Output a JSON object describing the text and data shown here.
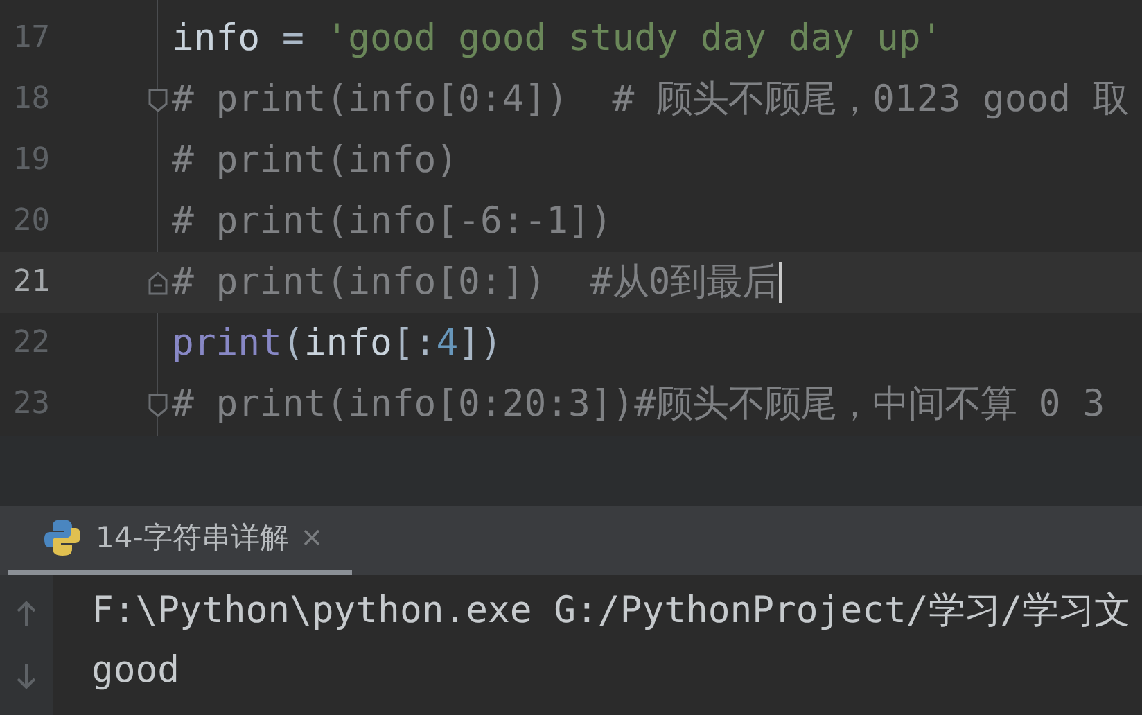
{
  "editor": {
    "lines": [
      {
        "number": "17",
        "current": false,
        "fold_start": false,
        "fold_end": false,
        "tokens": [
          {
            "kind": "ident",
            "text": "info "
          },
          {
            "kind": "op",
            "text": "= "
          },
          {
            "kind": "string",
            "text": "'good good study day day up'"
          }
        ]
      },
      {
        "number": "18",
        "current": false,
        "fold_start": true,
        "fold_end": false,
        "tokens": [
          {
            "kind": "comment",
            "text": "# print(info[0:4])  # 顾头不顾尾，0123 good 取"
          }
        ]
      },
      {
        "number": "19",
        "current": false,
        "fold_start": false,
        "fold_end": false,
        "tokens": [
          {
            "kind": "comment",
            "text": "# print(info)"
          }
        ]
      },
      {
        "number": "20",
        "current": false,
        "fold_start": false,
        "fold_end": false,
        "tokens": [
          {
            "kind": "comment",
            "text": "# print(info[-6:-1])"
          }
        ]
      },
      {
        "number": "21",
        "current": true,
        "fold_start": false,
        "fold_end": true,
        "tokens": [
          {
            "kind": "comment",
            "text": "# print(info[0:])  #从0到最后"
          }
        ]
      },
      {
        "number": "22",
        "current": false,
        "fold_start": false,
        "fold_end": false,
        "tokens": [
          {
            "kind": "builtin",
            "text": "print"
          },
          {
            "kind": "punct",
            "text": "("
          },
          {
            "kind": "ident",
            "text": "info"
          },
          {
            "kind": "punct",
            "text": "[:"
          },
          {
            "kind": "number",
            "text": "4"
          },
          {
            "kind": "punct",
            "text": "])"
          }
        ]
      },
      {
        "number": "23",
        "current": false,
        "fold_start": true,
        "fold_end": false,
        "tokens": [
          {
            "kind": "comment",
            "text": "# print(info[0:20:3])#顾头不顾尾，中间不算 0 3"
          }
        ]
      }
    ]
  },
  "run_tabs": [
    {
      "label": "14-字符串详解",
      "selected": true
    }
  ],
  "console": {
    "lines": [
      "F:\\Python\\python.exe G:/PythonProject/学习/学习文",
      "good"
    ]
  }
}
